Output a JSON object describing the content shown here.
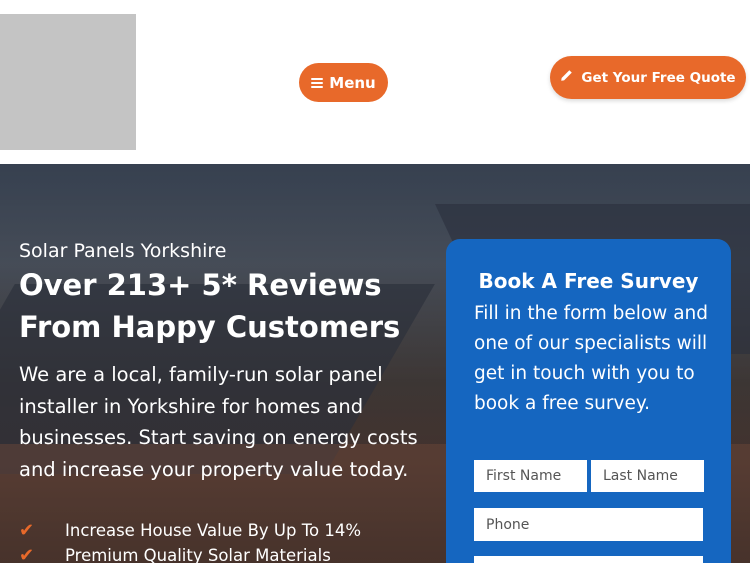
{
  "header": {
    "menu_label": "Menu",
    "menu_icon": "hamburger-icon",
    "quote_label": "Get Your Free Quote",
    "quote_icon": "pencil-icon",
    "accent_color": "#e8692a"
  },
  "hero": {
    "eyebrow": "Solar Panels Yorkshire",
    "title": "Over 213+ 5* Reviews From Happy Customers",
    "description": "We are a local, family-run solar panel installer in Yorkshire for homes and businesses. Start saving on energy costs and increase your property value today.",
    "features": [
      {
        "text": "Increase House Value By Up To 14%",
        "icon": "checkmark-icon"
      },
      {
        "text": "Premium Quality Solar Materials",
        "icon": "checkmark-icon"
      }
    ]
  },
  "form": {
    "title": "Book A Free Survey",
    "description": "Fill in the form below and one of our specialists will get in touch with you to book a free survey.",
    "first_name_placeholder": "First Name",
    "last_name_placeholder": "Last Name",
    "phone_placeholder": "Phone",
    "background_color": "#1566c0"
  }
}
